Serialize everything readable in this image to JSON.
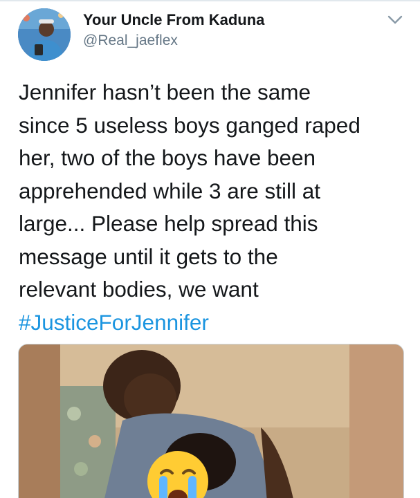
{
  "user": {
    "display_name": "Your Uncle From Kaduna",
    "handle": "@Real_jaeflex",
    "avatar_icon": "user-avatar"
  },
  "menu_icon": "chevron-down-icon",
  "tweet": {
    "lines": [
      "Jennifer hasn’t been the same",
      "since 5 useless boys ganged raped",
      "her, two of the boys have been",
      "apprehended while 3 are still at",
      "large... Please help spread this",
      "message until it gets to the",
      "relevant bodies, we want"
    ],
    "hashtag": "#JusticeForJennifer"
  },
  "media": {
    "emoji_icon": "loudly-crying-face-icon"
  },
  "colors": {
    "text": "#14171a",
    "secondary": "#657786",
    "link": "#1b95e0",
    "border": "#ccd6dd"
  }
}
